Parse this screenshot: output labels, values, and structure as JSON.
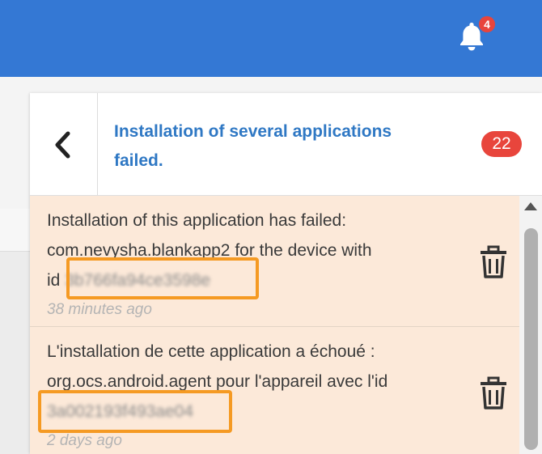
{
  "topbar": {
    "bell_icon": "bell-icon",
    "bell_count": "4"
  },
  "panel": {
    "back_icon": "chevron-left-icon",
    "title_line1": "Installation of several applications",
    "title_line2": "failed.",
    "count": "22"
  },
  "notifications": [
    {
      "line1": "Installation of this application has failed:",
      "line2": "com.nevysha.blankapp2 for the device with",
      "line3_prefix": "id",
      "device_id": "3b766fa94ce3598e",
      "time": "38 minutes ago",
      "delete_icon": "trash-icon"
    },
    {
      "line1": "L'installation de cette application a échoué :",
      "line2": "org.ocs.android.agent pour l'appareil avec l'id",
      "line3_prefix": "",
      "device_id": "3a002193f493ae04",
      "time": "2 days ago",
      "delete_icon": "trash-icon"
    }
  ],
  "colors": {
    "topbar": "#3478d4",
    "badge": "#e8453c",
    "title": "#2f78c4",
    "notification_bg": "#fce9d9",
    "highlight": "#f59a23"
  }
}
